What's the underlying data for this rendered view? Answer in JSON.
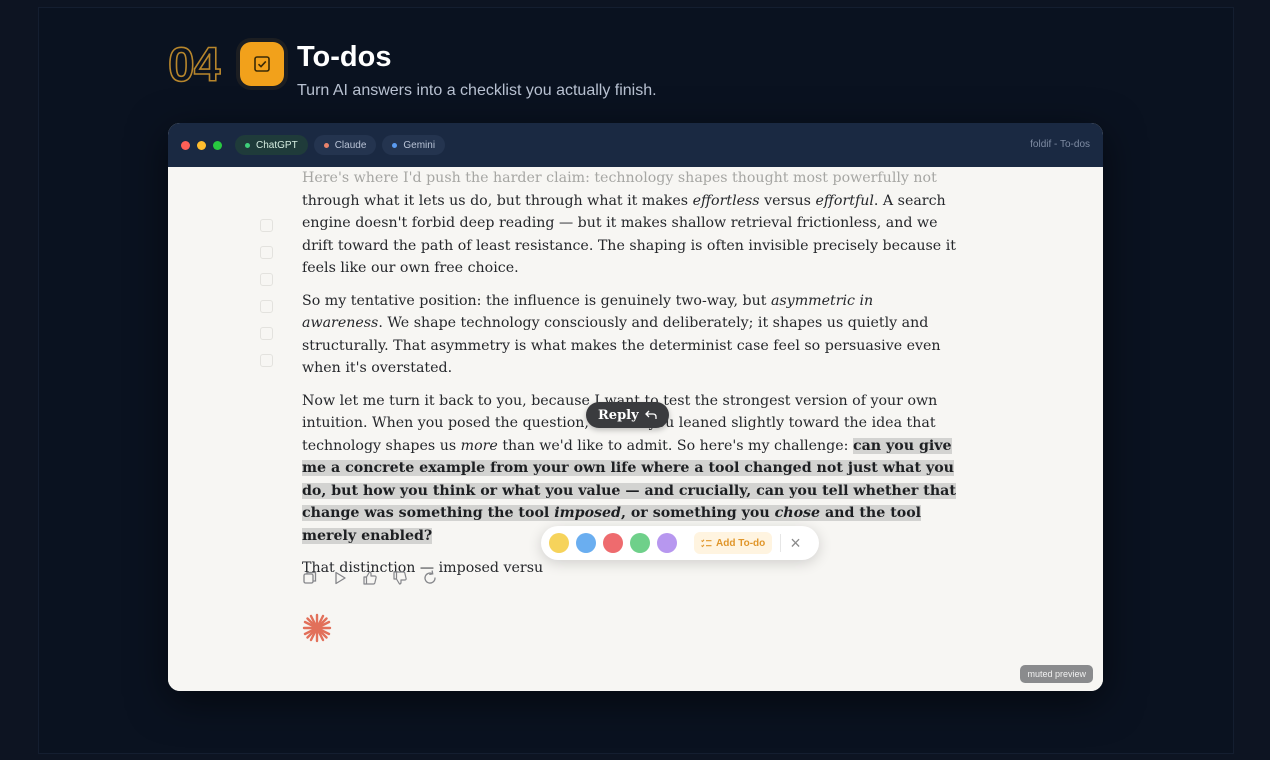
{
  "section": {
    "number": "04",
    "title": "To-dos",
    "subtitle": "Turn AI answers into a checklist you actually finish."
  },
  "window": {
    "title": "foldif - To-dos",
    "tabs": [
      {
        "label": "ChatGPT",
        "dot_color": "#3ecf7a",
        "active": true
      },
      {
        "label": "Claude",
        "dot_color": "#e8836b",
        "active": false
      },
      {
        "label": "Gemini",
        "dot_color": "#5b9bf0",
        "active": false
      }
    ],
    "traffic_lights": [
      "#ff5f57",
      "#febc2e",
      "#28c840"
    ]
  },
  "content": {
    "p1_faded": "Here's where I'd push the harder claim: technology shapes thought most powerfully not",
    "p1_a": "through what it lets us do, but through what it makes ",
    "p1_em1": "effortless",
    "p1_b": " versus ",
    "p1_em2": "effortful",
    "p1_c": ". A search engine doesn't forbid deep reading — but it makes shallow retrieval frictionless, and we drift toward the path of least resistance. The shaping is often invisible precisely because it feels like our own free choice.",
    "p2_a": "So my tentative position: the influence is genuinely two-way, but ",
    "p2_em": "asymmetric in awareness",
    "p2_b": ". We shape technology consciously and deliberately; it shapes us quietly and structurally. That asymmetry is what makes the determinist case feel so persuasive even when it's overstated.",
    "p3_a": "Now let me turn it back to you, because I want to test the strongest version of your own intuition. When you posed the question, I sense you leaned slightly toward the idea that technology shapes us ",
    "p3_em": "more",
    "p3_b": " than we'd like to admit. So here's my challenge: ",
    "p3_hl_a": "can you give me a concrete example from your own life where a tool changed not just what you do, but how you think or what you value — and crucially, can you tell whether that change was something the tool ",
    "p3_hl_em1": "imposed",
    "p3_hl_b": ", or something you ",
    "p3_hl_em2": "chose",
    "p3_hl_c": " and the tool merely enabled?",
    "p4": "That distinction — imposed versu"
  },
  "reply_button": {
    "label": "Reply",
    "icon": "reply-arrow-icon"
  },
  "highlight_toolbar": {
    "colors": [
      "#f6d35b",
      "#6aaef0",
      "#ee6b6e",
      "#6fd08a",
      "#b797ef"
    ],
    "add_todo_label": "Add To-do"
  },
  "message_actions": [
    "copy-icon",
    "play-icon",
    "thumbs-up-icon",
    "thumbs-down-icon",
    "retry-icon"
  ],
  "badge": "muted preview",
  "colors": {
    "accent": "#f2a11b",
    "titlebar": "#1a2942",
    "background": "#0d1422"
  }
}
